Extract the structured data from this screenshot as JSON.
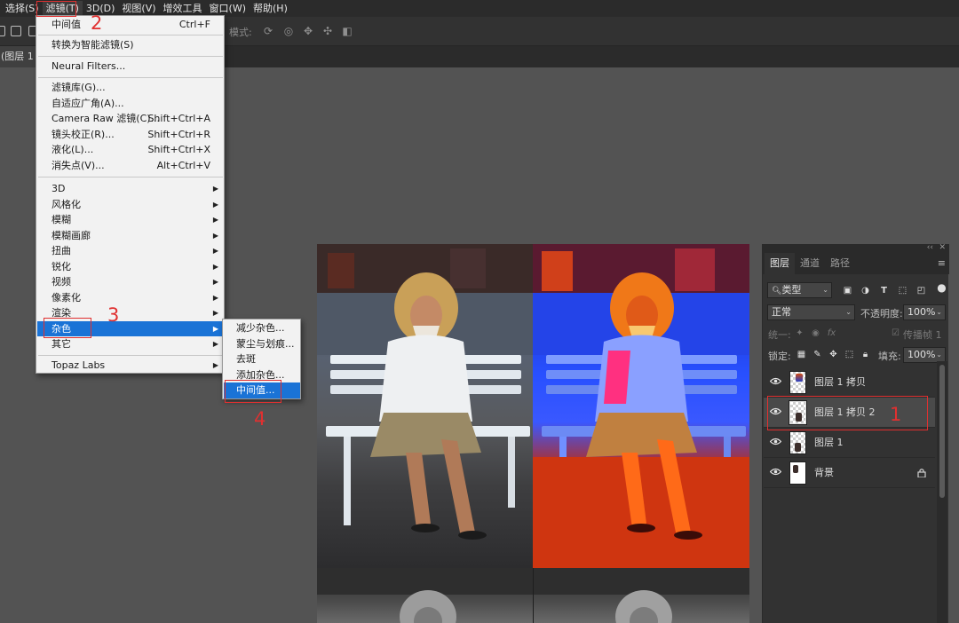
{
  "menubar": {
    "items": [
      "选择(S)",
      "滤镜(T)",
      "3D(D)",
      "视图(V)",
      "增效工具",
      "窗口(W)",
      "帮助(H)"
    ],
    "active_index": 1
  },
  "options_bar": {
    "mode_label": "模式:"
  },
  "doc_tab": {
    "title": "(图层 1 拷"
  },
  "filter_menu": {
    "items": [
      {
        "label": "中间值",
        "shortcut": "Ctrl+F"
      },
      {
        "label": "转换为智能滤镜(S)"
      },
      {
        "label": "Neural Filters..."
      },
      {
        "label": "滤镜库(G)..."
      },
      {
        "label": "自适应广角(A)..."
      },
      {
        "label": "Camera Raw 滤镜(C)...",
        "shortcut": "Shift+Ctrl+A"
      },
      {
        "label": "镜头校正(R)...",
        "shortcut": "Shift+Ctrl+R"
      },
      {
        "label": "液化(L)...",
        "shortcut": "Shift+Ctrl+X"
      },
      {
        "label": "消失点(V)...",
        "shortcut": "Alt+Ctrl+V"
      },
      {
        "label": "3D",
        "submenu": true
      },
      {
        "label": "风格化",
        "submenu": true
      },
      {
        "label": "模糊",
        "submenu": true
      },
      {
        "label": "模糊画廊",
        "submenu": true
      },
      {
        "label": "扭曲",
        "submenu": true
      },
      {
        "label": "锐化",
        "submenu": true
      },
      {
        "label": "视频",
        "submenu": true
      },
      {
        "label": "像素化",
        "submenu": true
      },
      {
        "label": "渲染",
        "submenu": true
      },
      {
        "label": "杂色",
        "submenu": true,
        "highlighted": true
      },
      {
        "label": "其它",
        "submenu": true
      },
      {
        "label": "Topaz Labs",
        "submenu": true
      }
    ]
  },
  "noise_submenu": {
    "items": [
      {
        "label": "减少杂色..."
      },
      {
        "label": "蒙尘与划痕..."
      },
      {
        "label": "去斑"
      },
      {
        "label": "添加杂色..."
      },
      {
        "label": "中间值...",
        "highlighted": true
      }
    ]
  },
  "annotations": [
    "2",
    "3",
    "4",
    "1"
  ],
  "layers_panel": {
    "tabs": [
      "图层",
      "通道",
      "路径"
    ],
    "active_tab": 0,
    "filter_kind": "类型",
    "blend_mode": "正常",
    "opacity_label": "不透明度:",
    "opacity_value": "100%",
    "unify_label": "统一:",
    "propagate_label": "传播帧 1",
    "lock_label": "锁定:",
    "fill_label": "填充:",
    "fill_value": "100%",
    "layers": [
      {
        "name": "图层 1 拷贝",
        "visible": true,
        "selected": false
      },
      {
        "name": "图层 1 拷贝 2",
        "visible": true,
        "selected": true
      },
      {
        "name": "图层 1",
        "visible": true,
        "selected": false
      },
      {
        "name": "背景",
        "visible": true,
        "selected": false,
        "locked": true
      }
    ]
  },
  "colors": {
    "accent": "#1a73d6",
    "annotation": "#e03030",
    "panel_bg": "#323232",
    "workspace_bg": "#535353"
  }
}
